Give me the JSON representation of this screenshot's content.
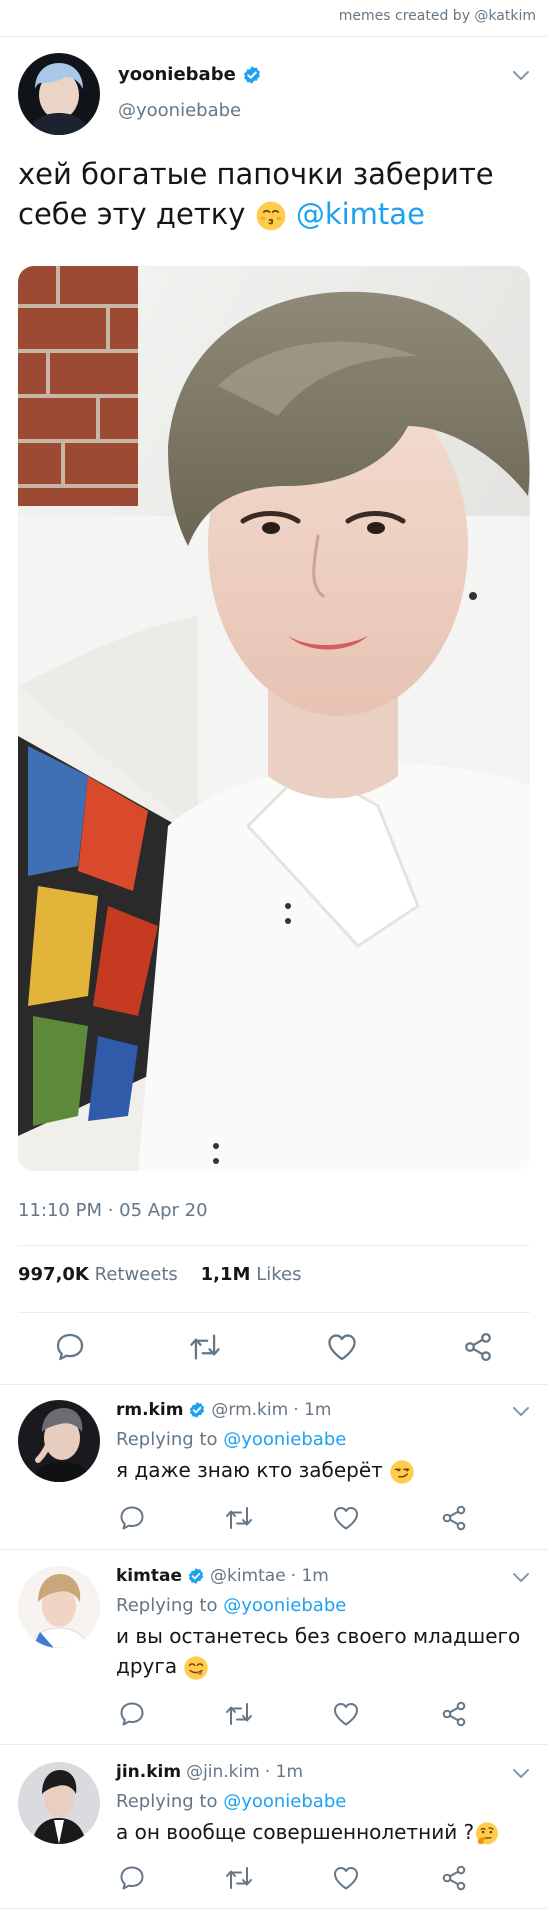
{
  "credit": "memes created by @katkim",
  "tweet": {
    "name": "yooniebabe",
    "handle": "@yooniebabe",
    "text_line1": "хей богатые папочки заберите",
    "text_line2_prefix": "себе эту детку ",
    "mention": "@kimtae",
    "timestamp": "11:10 PM · 05 Apr 20",
    "retweets_count": "997,0K",
    "retweets_label": "Retweets",
    "likes_count": "1,1M",
    "likes_label": "Likes"
  },
  "replies": [
    {
      "name": "rm.kim",
      "handle": "@rm.kim",
      "time": "· 1m",
      "replying_prefix": "Replying to",
      "replying_to": "@yooniebabe",
      "text": "я даже знаю кто заберёт"
    },
    {
      "name": "kimtae",
      "handle": "@kimtae",
      "time": "· 1m",
      "replying_prefix": "Replying to",
      "replying_to": "@yooniebabe",
      "text_line1": "и вы останетесь без своего младшего",
      "text_line2": "друга"
    },
    {
      "name": "jin.kim",
      "handle": "@jin.kim",
      "time": "· 1m",
      "replying_prefix": "Replying to",
      "replying_to": "@yooniebabe",
      "text": "а он вообще совершеннолетний ?"
    }
  ],
  "colors": {
    "accent": "#1da1f2",
    "secondary_text": "#657786",
    "divider": "#e6ecf0"
  },
  "icons": [
    "verified-icon",
    "chevron-down-icon",
    "reply-icon",
    "retweet-icon",
    "like-icon",
    "share-icon"
  ]
}
